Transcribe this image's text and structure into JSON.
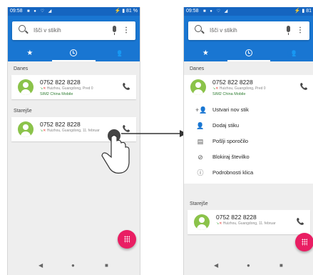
{
  "status": {
    "time": "09:58",
    "left_right_text": "81 %",
    "right_right_text": "81"
  },
  "search": {
    "placeholder": "Išči v stikih"
  },
  "tabs": [
    {
      "icon": "star-icon",
      "active": false
    },
    {
      "icon": "clock-icon",
      "active": true
    },
    {
      "icon": "people-icon",
      "active": false
    }
  ],
  "sections": {
    "today": "Danes",
    "older": "Starejše"
  },
  "calls": [
    {
      "number": "0752 822 8228",
      "location": "Huizhou, Guangdong, Pred 0",
      "carrier": "SIM2 China Mobile"
    },
    {
      "number": "0752 822 8228",
      "location": "Huizhou, Guangdong, 11. februar"
    }
  ],
  "context_menu": [
    {
      "icon": "add-contact-icon",
      "label": "Ustvari nov stik"
    },
    {
      "icon": "person-icon",
      "label": "Dodaj stiku"
    },
    {
      "icon": "message-icon",
      "label": "Pošlji sporočilo"
    },
    {
      "icon": "block-icon",
      "label": "Blokiraj številko"
    },
    {
      "icon": "info-icon",
      "label": "Podrobnosti klica"
    }
  ],
  "colors": {
    "primary": "#1976d2",
    "status": "#1565c0",
    "fab": "#e91e63",
    "avatar": "#8bc34a",
    "carrier": "#2e7d32"
  }
}
